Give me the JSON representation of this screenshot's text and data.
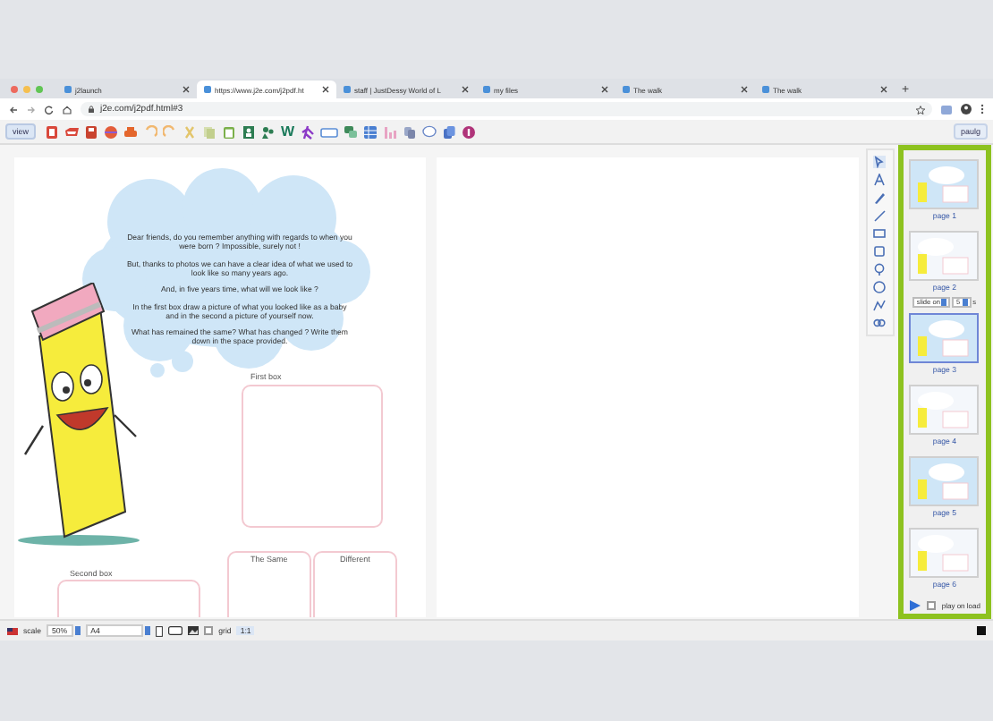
{
  "browser": {
    "tabs": [
      {
        "label": "j2launch",
        "selected": false
      },
      {
        "label": "https://www.j2e.com/j2pdf.ht",
        "selected": true
      },
      {
        "label": "staff | JustDessy World of L",
        "selected": false
      },
      {
        "label": "my files",
        "selected": false
      },
      {
        "label": "The walk",
        "selected": false
      },
      {
        "label": "The walk",
        "selected": false
      }
    ],
    "new_tab": "+",
    "url": "j2e.com/j2pdf.html#3"
  },
  "toolbar": {
    "view_button": "view",
    "word_icon": "W",
    "user": "paulg"
  },
  "worksheet": {
    "paragraphs": [
      "Dear friends, do you remember anything with regards to when you were born ? Impossible, surely not !",
      "But, thanks to photos we can have a clear idea of what we used to look like so many years ago.",
      "And, in five years time, what will we look like ?",
      "In the first box draw a picture of what you looked like as a baby and in the second  a picture of yourself now.",
      "What has remained the same? What has changed ?  Write them down in the space provided."
    ],
    "boxes": [
      {
        "label": "First box"
      },
      {
        "label": "Second box"
      },
      {
        "label": "The Same"
      },
      {
        "label": "Different"
      }
    ]
  },
  "pages_panel": {
    "pages": [
      {
        "label": "page 1",
        "selected": false
      },
      {
        "label": "page 2",
        "selected": false
      },
      {
        "label": "page 3",
        "selected": true
      },
      {
        "label": "page 4",
        "selected": false
      },
      {
        "label": "page 5",
        "selected": false
      },
      {
        "label": "page 6",
        "selected": false
      }
    ],
    "slide_controls": {
      "mode": "slide on",
      "seconds": "5",
      "unit": "s"
    },
    "play_on_load": {
      "label": "play on load",
      "checked": false
    }
  },
  "status_bar": {
    "scale_label": "scale",
    "scale": "50%",
    "paper": "A4",
    "grid": {
      "label": "grid",
      "checked": false
    },
    "ratio_button": "1:1"
  }
}
